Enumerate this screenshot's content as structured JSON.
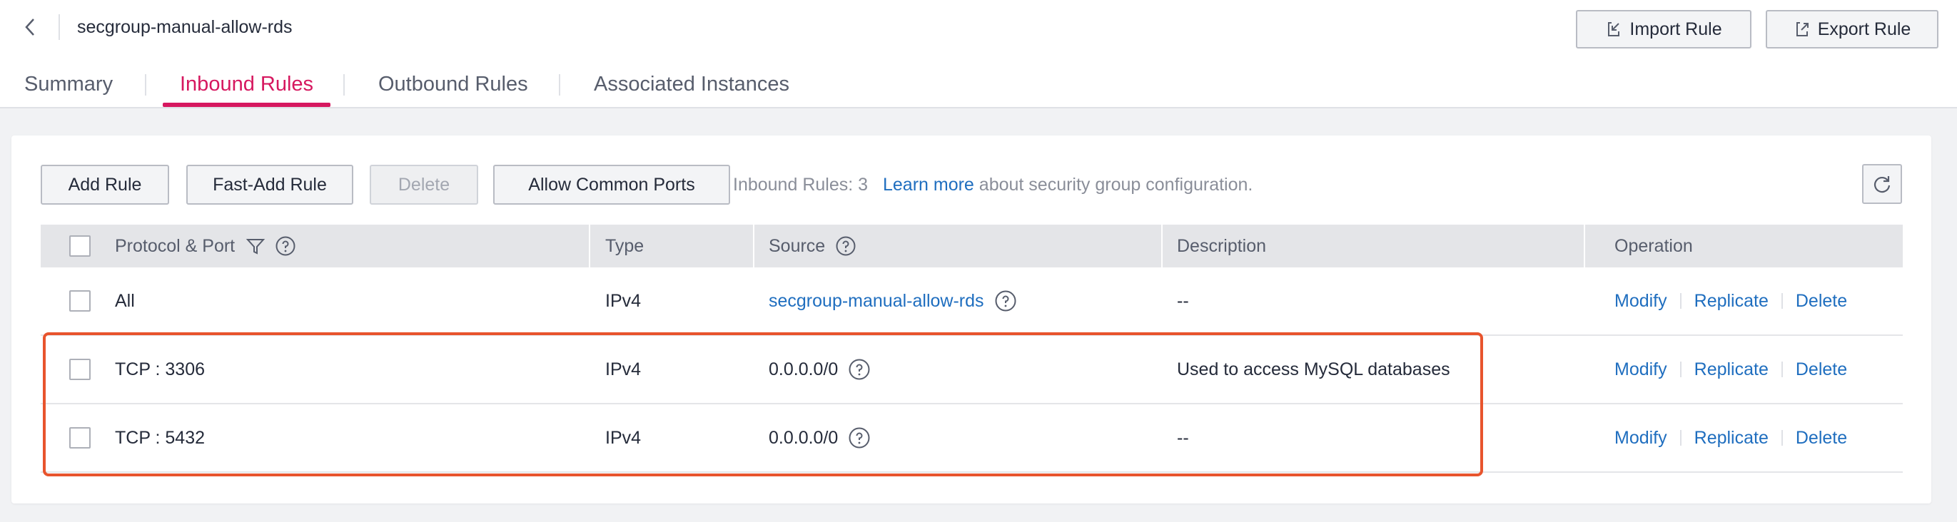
{
  "header": {
    "title": "secgroup-manual-allow-rds",
    "import_label": "Import Rule",
    "export_label": "Export Rule"
  },
  "tabs": [
    {
      "label": "Summary",
      "active": false
    },
    {
      "label": "Inbound Rules",
      "active": true
    },
    {
      "label": "Outbound Rules",
      "active": false
    },
    {
      "label": "Associated Instances",
      "active": false
    }
  ],
  "toolbar": {
    "add_rule": "Add Rule",
    "fast_add_rule": "Fast-Add Rule",
    "delete": "Delete",
    "allow_common_ports": "Allow Common Ports",
    "rules_count_text": "Inbound Rules: 3",
    "learn_more": "Learn more",
    "learn_more_suffix": "about security group configuration."
  },
  "table": {
    "columns": {
      "protocol_port": "Protocol & Port",
      "type": "Type",
      "source": "Source",
      "description": "Description",
      "operation": "Operation"
    },
    "rows": [
      {
        "protocol_port": "All",
        "type": "IPv4",
        "source": "secgroup-manual-allow-rds",
        "source_is_link": true,
        "description": "--"
      },
      {
        "protocol_port": "TCP : 3306",
        "type": "IPv4",
        "source": "0.0.0.0/0",
        "source_is_link": false,
        "description": "Used to access MySQL databases"
      },
      {
        "protocol_port": "TCP : 5432",
        "type": "IPv4",
        "source": "0.0.0.0/0",
        "source_is_link": false,
        "description": "--"
      }
    ],
    "operations": {
      "modify": "Modify",
      "replicate": "Replicate",
      "delete": "Delete"
    }
  },
  "colors": {
    "accent": "#d6185f",
    "link": "#1f6ebf",
    "highlight": "#e8542d"
  },
  "icons": {
    "back": "chevron-left-icon",
    "import": "import-icon",
    "export": "export-icon",
    "filter": "filter-icon",
    "help": "question-circle-icon",
    "refresh": "refresh-icon"
  }
}
